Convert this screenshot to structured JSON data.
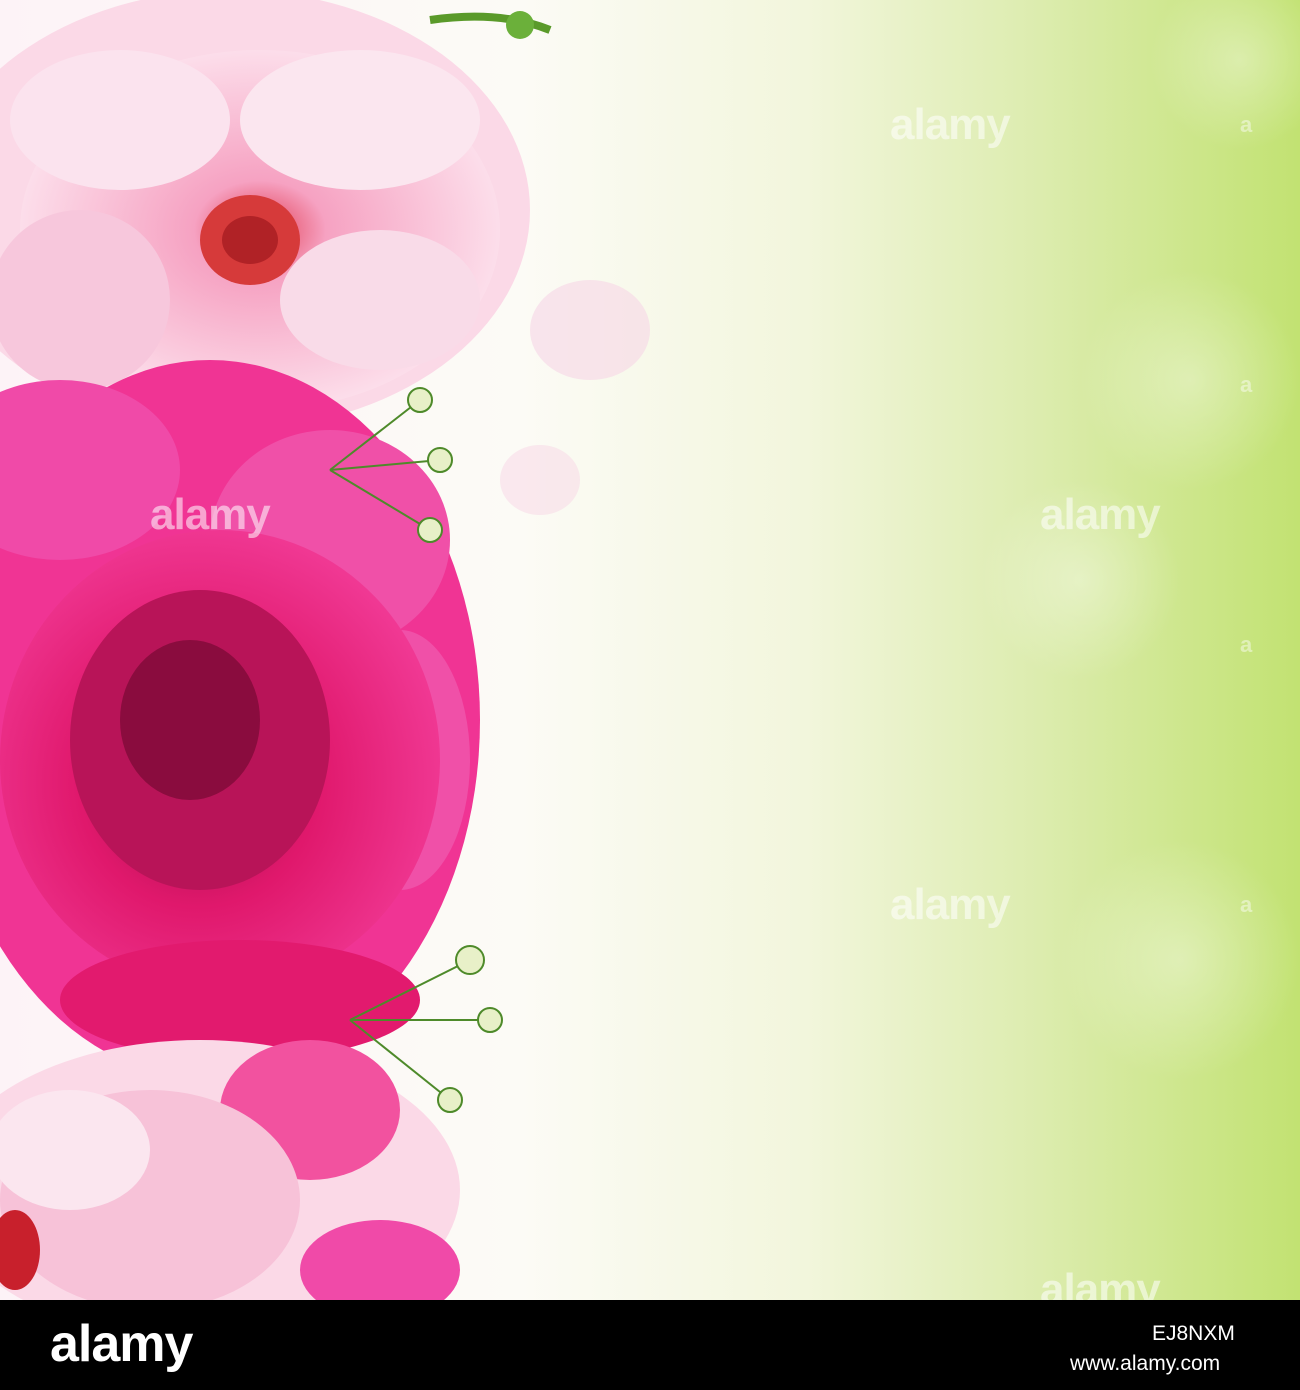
{
  "image": {
    "subject": "pink peonies border",
    "colors": {
      "hot_pink": "#e21a6e",
      "light_pink": "#f7b7d2",
      "green": "#c2e272",
      "cream": "#fcfbf6"
    }
  },
  "watermarks": [
    "alamy",
    "alamy",
    "alamy",
    "alamy",
    "alamy",
    "a",
    "a",
    "a",
    "a"
  ],
  "footer": {
    "brand": "alamy",
    "image_id": "EJ8NXM",
    "url": "www.alamy.com"
  }
}
